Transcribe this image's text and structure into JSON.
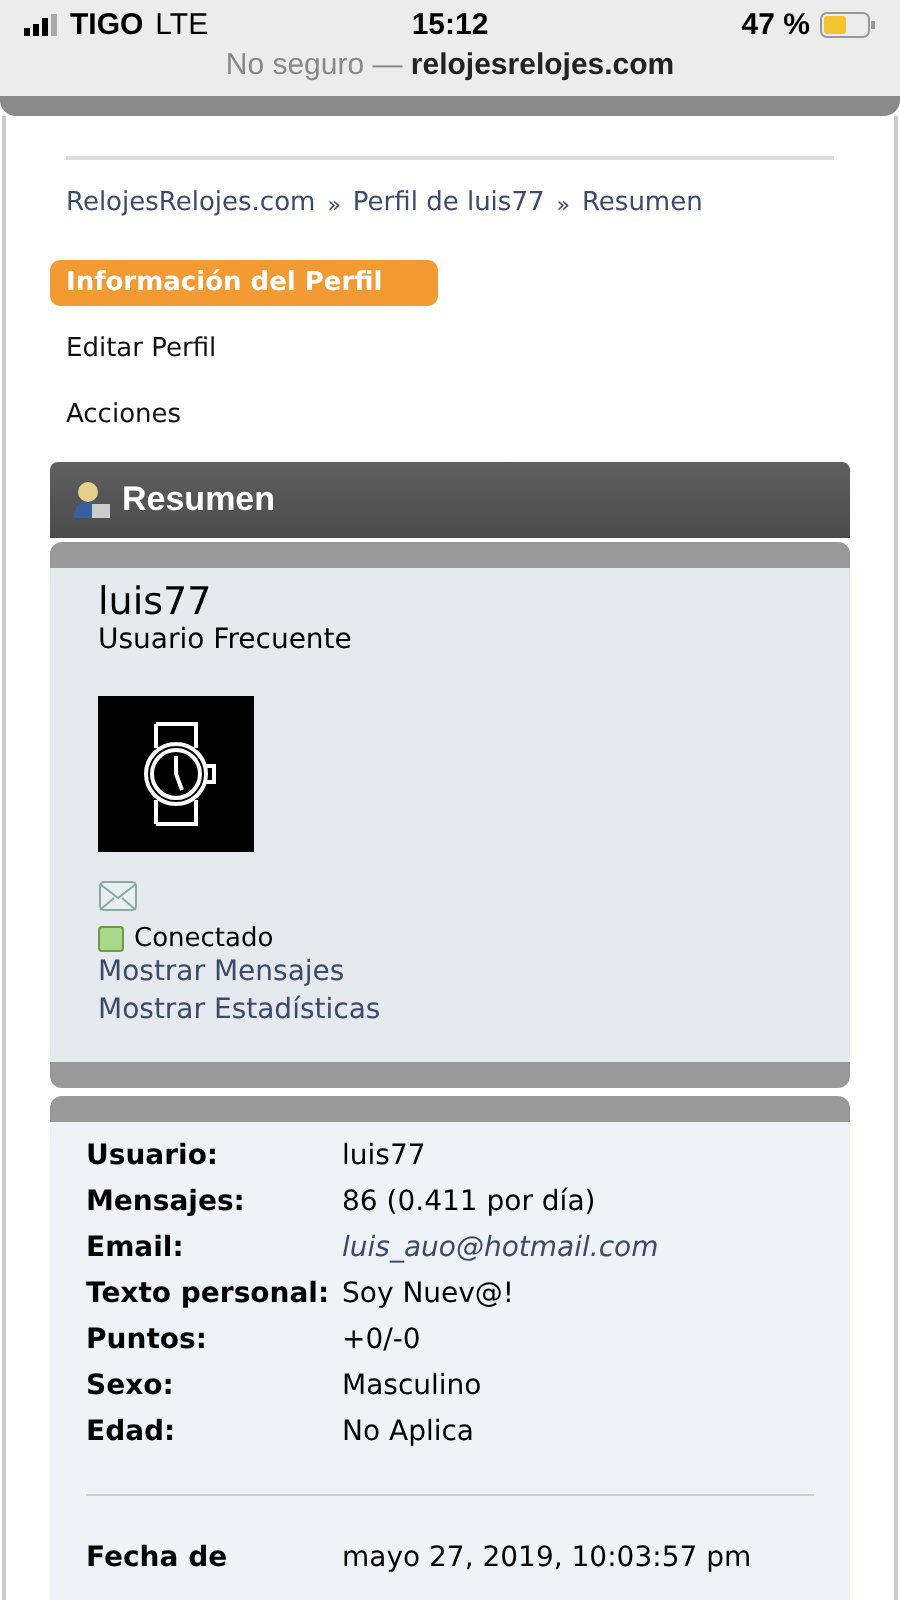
{
  "status_bar": {
    "carrier": "TIGO",
    "network": "LTE",
    "time": "15:12",
    "battery": "47 %"
  },
  "address_bar": {
    "security": "No seguro —",
    "domain": "relojesrelojes.com"
  },
  "breadcrumb": [
    "RelojesRelojes.com",
    "»",
    "Perfil de luis77",
    "»",
    "Resumen"
  ],
  "tabs": [
    {
      "label": "Información del Perfil",
      "selected": true
    },
    {
      "label": "Editar Perfil",
      "selected": false
    },
    {
      "label": "Acciones",
      "selected": false
    }
  ],
  "section_title": "Resumen",
  "profile": {
    "username": "luis77",
    "rank": "Usuario Frecuente",
    "status": "Conectado",
    "online": true,
    "links": [
      "Mostrar Mensajes",
      "Mostrar Estadísticas"
    ]
  },
  "details": [
    {
      "label": "Usuario:",
      "value": "luis77",
      "kind": "text"
    },
    {
      "label": "Mensajes:",
      "value": "86 (0.411 por día)",
      "kind": "text"
    },
    {
      "label": "Email:",
      "value": "luis_auo@hotmail.com",
      "kind": "email"
    },
    {
      "label": "Texto personal:",
      "value": "Soy Nuev@!",
      "kind": "text"
    },
    {
      "label": "Puntos:",
      "value": "+0/-0",
      "kind": "text"
    },
    {
      "label": "Sexo:",
      "value": "Masculino",
      "kind": "text"
    },
    {
      "label": "Edad:",
      "value": "No Aplica",
      "kind": "text"
    }
  ],
  "registration": {
    "label": "Fecha de",
    "value": "mayo 27, 2019, 10:03:57 pm"
  }
}
